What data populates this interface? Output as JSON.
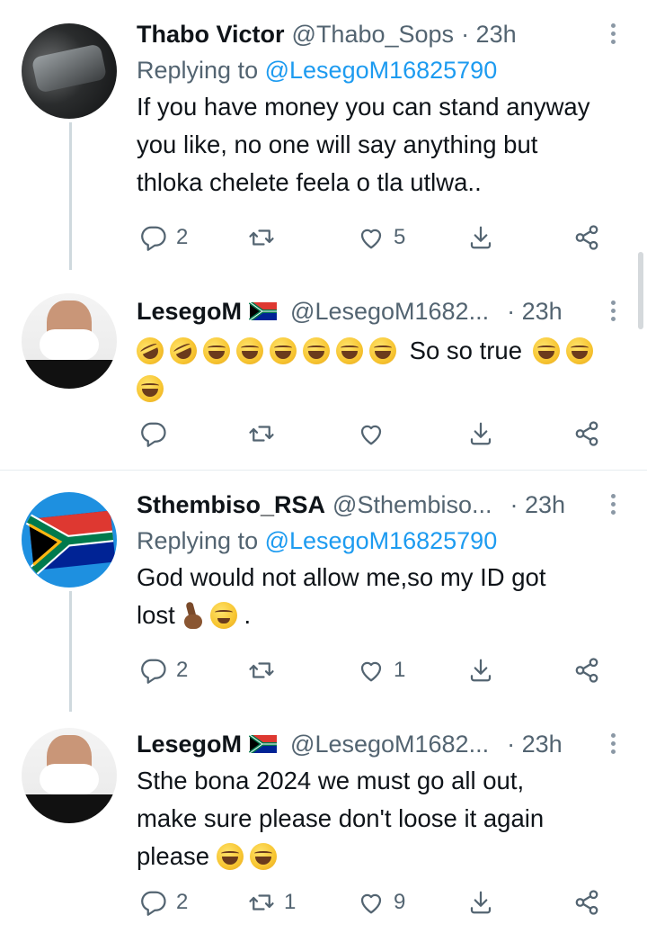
{
  "tweets": [
    {
      "name": "Thabo Victor",
      "handle": "@Thabo_Sops",
      "time": "· 23h",
      "replying_label": "Replying to",
      "replying_to": "@LesegoM16825790",
      "text_lines": [
        "If you have money you can stand anyway",
        "you like, no one will say anything but",
        "thloka chelete feela o tla utlwa.."
      ],
      "replies": "2",
      "retweets": "",
      "likes": "5"
    },
    {
      "name": "LesegoM",
      "flag": "south-africa-flag-icon",
      "handle": "@LesegoM1682...",
      "time": "· 23h",
      "text_after_emojis": "So so true",
      "replies": "",
      "retweets": "",
      "likes": ""
    },
    {
      "name": "Sthembiso_RSA",
      "handle": "@Sthembiso...",
      "time": "· 23h",
      "replying_label": "Replying to",
      "replying_to": "@LesegoM16825790",
      "text_line1": "God would not allow me,so my ID got",
      "text_line2": "lost",
      "text_end": ".",
      "replies": "2",
      "retweets": "",
      "likes": "1"
    },
    {
      "name": "LesegoM",
      "flag": "south-africa-flag-icon",
      "handle": "@LesegoM1682...",
      "time": "· 23h",
      "text_lines": [
        "Sthe bona 2024 we must go all out,",
        "make sure please don't loose it again",
        "please"
      ],
      "replies": "2",
      "retweets": "1",
      "likes": "9"
    }
  ],
  "colors": {
    "text": "#0f1419",
    "muted": "#536471",
    "link": "#1d9bf0",
    "thread_line": "#cfd9de"
  },
  "icons": [
    "reply-icon",
    "retweet-icon",
    "like-icon",
    "bookmark-icon",
    "share-icon",
    "more-icon"
  ]
}
